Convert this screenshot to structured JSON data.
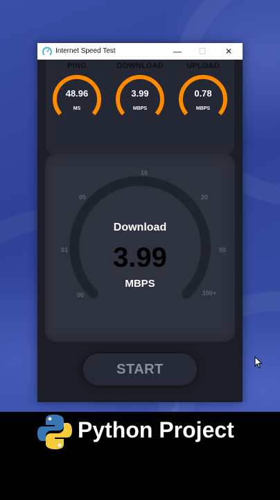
{
  "window": {
    "title": "Internet Speed Test",
    "controls": {
      "minimize": "—",
      "maximize": "☐",
      "close": "✕"
    }
  },
  "metrics": [
    {
      "label": "PING",
      "value": "48.96",
      "unit": "MS"
    },
    {
      "label": "DOWNLOAD",
      "value": "3.99",
      "unit": "MBPS"
    },
    {
      "label": "UPLOAD",
      "value": "0.78",
      "unit": "MBPS"
    }
  ],
  "main_gauge": {
    "label": "Download",
    "value": "3.99",
    "unit": "MBPS",
    "ticks": [
      "00",
      "01",
      "05",
      "10",
      "20",
      "50",
      "100+"
    ]
  },
  "start_button": {
    "label": "START"
  },
  "banner": {
    "text": "Python Project"
  },
  "colors": {
    "accent_orange": "#ff8a00",
    "card_bg": "#2f3340",
    "window_bg": "#1b1e26",
    "track": "#1f232c"
  },
  "icons": {
    "app": "speed-gauge-icon",
    "cursor": "mouse-pointer-icon",
    "banner": "python-logo-icon"
  }
}
